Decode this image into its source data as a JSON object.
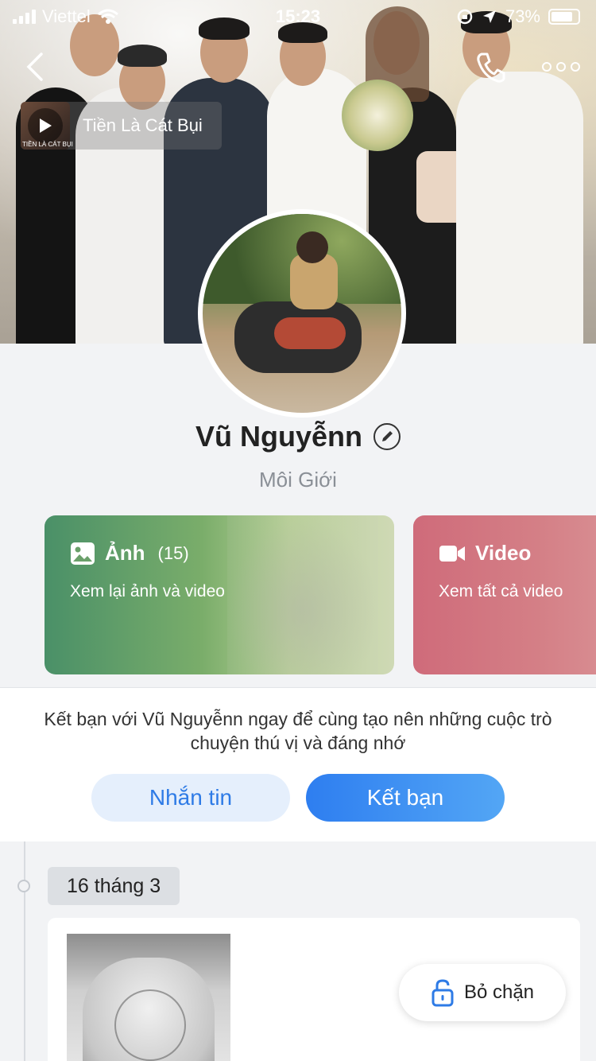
{
  "status_bar": {
    "carrier": "Viettel",
    "time": "15:23",
    "battery": "73%"
  },
  "music": {
    "title": "Tiền Là Cát Bụi",
    "thumb_caption": "TIỀN LÀ CÁT BỤI"
  },
  "profile": {
    "name": "Vũ Nguyễnn",
    "subtitle": "Môi Giới"
  },
  "cards": {
    "photos": {
      "title": "Ảnh",
      "count": "(15)",
      "subtitle": "Xem lại ảnh và video"
    },
    "video": {
      "title": "Video",
      "subtitle": "Xem tất cả video"
    }
  },
  "friend": {
    "prompt": "Kết bạn với Vũ Nguyễnn ngay để cùng tạo nên những cuộc trò chuyện thú vị và đáng nhớ",
    "message_label": "Nhắn tin",
    "add_label": "Kết bạn"
  },
  "timeline": {
    "date": "16 tháng 3"
  },
  "unblock_label": "Bỏ chặn",
  "icons": [
    "back-icon",
    "phone-icon",
    "more-icon",
    "play-icon",
    "edit-icon",
    "image-icon",
    "video-camera-icon",
    "unlock-icon",
    "wifi-icon",
    "location-icon"
  ],
  "colors": {
    "primary_blue": "#2e7ef0",
    "photos_card": "#4a9068",
    "video_card": "#cf6b7a"
  }
}
